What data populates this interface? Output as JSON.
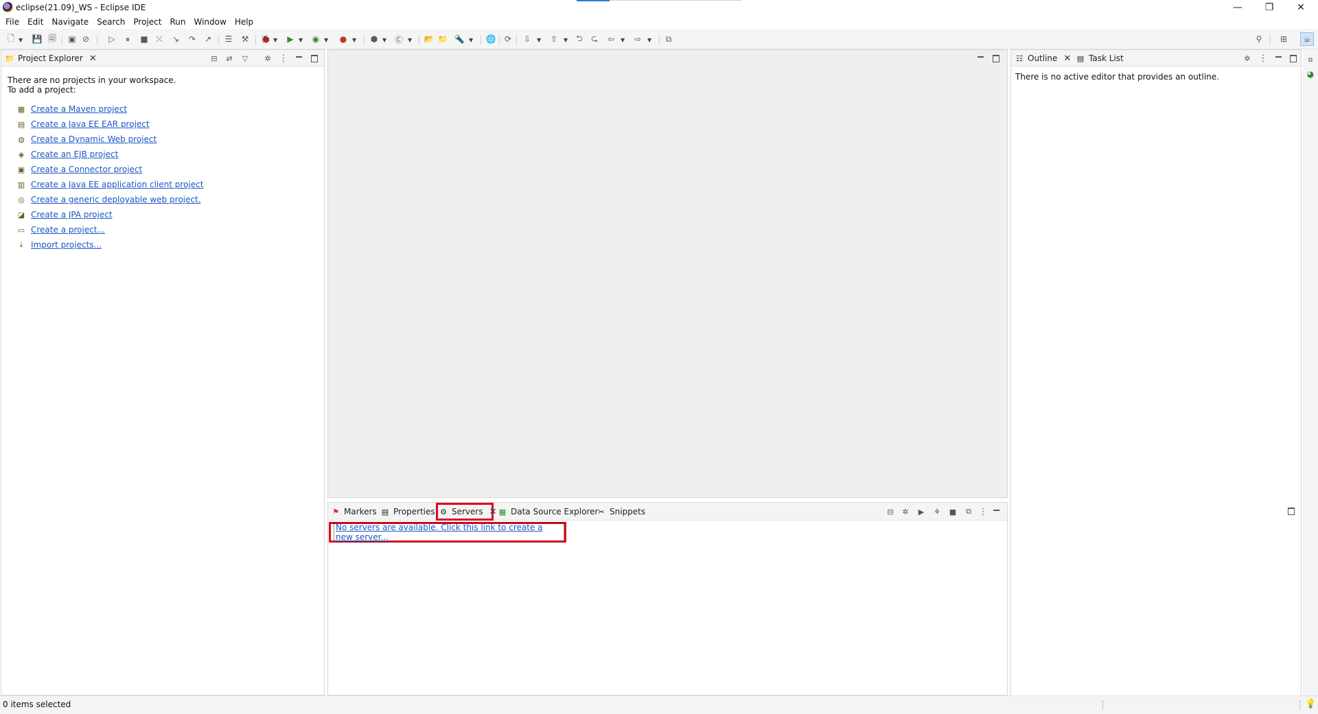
{
  "window": {
    "title": "eclipse(21.09)_WS - Eclipse IDE",
    "minimize": "—",
    "restore": "❐",
    "close": "✕"
  },
  "menu": [
    "File",
    "Edit",
    "Navigate",
    "Search",
    "Project",
    "Run",
    "Window",
    "Help"
  ],
  "project_explorer": {
    "tab_label": "Project Explorer",
    "message_line1": "There are no projects in your workspace.",
    "message_line2": "To add a project:",
    "links": [
      "Create a Maven project",
      "Create a Java EE EAR project",
      "Create a Dynamic Web project",
      "Create an EJB project",
      "Create a Connector project",
      "Create a Java EE application client project",
      "Create a generic deployable web project.",
      "Create a JPA project",
      "Create a project...",
      "Import projects..."
    ]
  },
  "outline": {
    "tab_label": "Outline",
    "task_list_label": "Task List",
    "message": "There is no active editor that provides an outline."
  },
  "bottom": {
    "tabs": [
      "Markers",
      "Properties",
      "Servers",
      "Data Source Explorer",
      "Snippets"
    ],
    "servers_link": "No servers are available. Click this link to create a new server..."
  },
  "status": {
    "text": "0 items selected"
  },
  "colors": {
    "highlight_box": "#e3001b",
    "link": "#1a56c7"
  }
}
